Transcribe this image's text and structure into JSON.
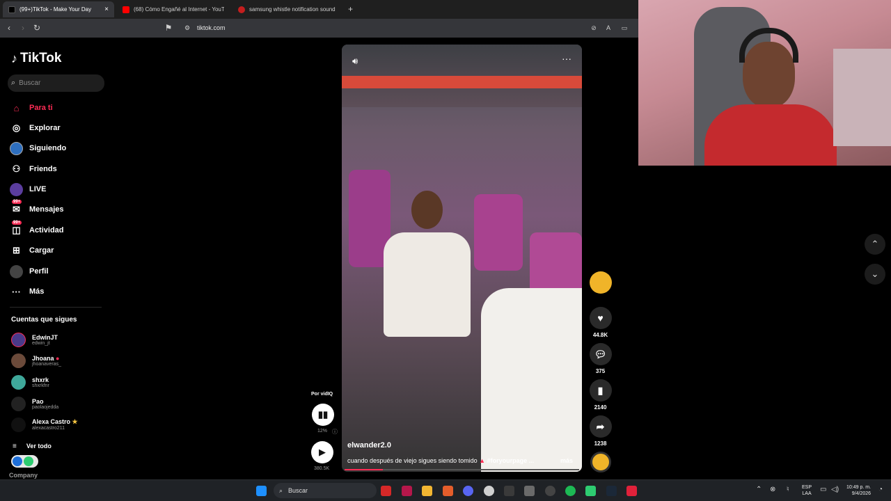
{
  "tabs": [
    {
      "label": "(99+)TikTok - Make Your Day",
      "color": "#000000"
    },
    {
      "label": "(68) Cómo Engañé al Internet - YouT",
      "color": "#ff0000"
    },
    {
      "label": "samsung whistle notification sound",
      "color": "#c41e1e"
    }
  ],
  "address": "tiktok.com",
  "brand": {
    "name": "TikTok",
    "accent": "#fe2c55"
  },
  "search_placeholder": "Buscar",
  "nav": [
    {
      "label": "Para ti",
      "icon": "home-icon",
      "active": true
    },
    {
      "label": "Explorar",
      "icon": "compass-icon"
    },
    {
      "label": "Siguiendo",
      "icon": "following-avatar-icon"
    },
    {
      "label": "Friends",
      "icon": "friends-icon"
    },
    {
      "label": "LIVE",
      "icon": "live-icon"
    },
    {
      "label": "Mensajes",
      "icon": "messages-icon",
      "badge": "99+"
    },
    {
      "label": "Actividad",
      "icon": "activity-icon",
      "badge": "99+"
    },
    {
      "label": "Cargar",
      "icon": "upload-icon"
    },
    {
      "label": "Perfil",
      "icon": "profile-icon"
    },
    {
      "label": "Más",
      "icon": "more-icon"
    }
  ],
  "following_header": "Cuentas que sigues",
  "following": [
    {
      "name": "EdwinJT",
      "handle": "edwin_jt"
    },
    {
      "name": "Jhoana",
      "handle": "jhoanaveras_"
    },
    {
      "name": "shxrk",
      "handle": "shxrkfnr"
    },
    {
      "name": "Pao",
      "handle": "paolaojedda"
    },
    {
      "name": "Alexa Castro",
      "handle": "alexacastro211"
    }
  ],
  "see_all": "Ver todo",
  "company": "Company",
  "video": {
    "author": "elwander2.0",
    "caption": "cuando después de viejo sigues siendo tomido",
    "hashtag": "#foryourpage ...",
    "more": "más"
  },
  "actions": {
    "likes": "44.8K",
    "comments": "375",
    "saves": "2140",
    "shares": "1238"
  },
  "sound_widget": {
    "label": "Por vidIQ",
    "percent": "12%",
    "views": "380.5K"
  },
  "taskbar": {
    "search": "Buscar",
    "lang": "ESP",
    "lang2": "LAA",
    "time": "10:49 p. m.",
    "date": "9/4/2026"
  }
}
